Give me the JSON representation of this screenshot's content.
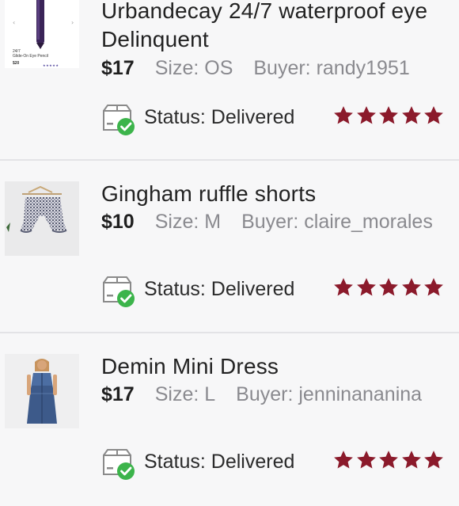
{
  "colors": {
    "background": "#f7f7f8",
    "divider": "#e3e3e6",
    "star": "#8b1a2b",
    "check": "#3cb44b",
    "muted": "#8a8a8f"
  },
  "listings": [
    {
      "title": "Urbandecay 24/7 waterproof eye",
      "title_line2": "Delinquent",
      "price": "$17",
      "size": "Size: OS",
      "buyer": "Buyer: randy1951",
      "status_label": "Status:",
      "status_value": "Delivered",
      "rating": 5,
      "thumb_icon": "eyeliner-pencil-icon",
      "thumb_text": {
        "name": "24/7",
        "sub": "Glide-On Eye Pencil",
        "price": "$20"
      }
    },
    {
      "title": "Gingham ruffle shorts",
      "price": "$10",
      "size": "Size: M",
      "buyer": "Buyer: claire_morales",
      "status_label": "Status:",
      "status_value": "Delivered",
      "rating": 5,
      "thumb_icon": "gingham-shorts-icon"
    },
    {
      "title": "Demin Mini Dress",
      "price": "$17",
      "size": "Size: L",
      "buyer": "Buyer: jenninananina",
      "status_label": "Status:",
      "status_value": "Delivered",
      "rating": 5,
      "thumb_icon": "denim-dress-icon"
    }
  ]
}
